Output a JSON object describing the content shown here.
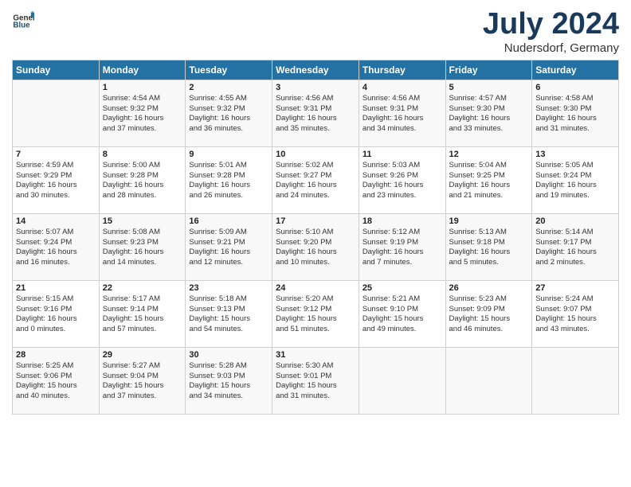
{
  "header": {
    "logo_general": "General",
    "logo_blue": "Blue",
    "month": "July 2024",
    "location": "Nudersdorf, Germany"
  },
  "days_of_week": [
    "Sunday",
    "Monday",
    "Tuesday",
    "Wednesday",
    "Thursday",
    "Friday",
    "Saturday"
  ],
  "weeks": [
    [
      {
        "day": "",
        "info": ""
      },
      {
        "day": "1",
        "info": "Sunrise: 4:54 AM\nSunset: 9:32 PM\nDaylight: 16 hours\nand 37 minutes."
      },
      {
        "day": "2",
        "info": "Sunrise: 4:55 AM\nSunset: 9:32 PM\nDaylight: 16 hours\nand 36 minutes."
      },
      {
        "day": "3",
        "info": "Sunrise: 4:56 AM\nSunset: 9:31 PM\nDaylight: 16 hours\nand 35 minutes."
      },
      {
        "day": "4",
        "info": "Sunrise: 4:56 AM\nSunset: 9:31 PM\nDaylight: 16 hours\nand 34 minutes."
      },
      {
        "day": "5",
        "info": "Sunrise: 4:57 AM\nSunset: 9:30 PM\nDaylight: 16 hours\nand 33 minutes."
      },
      {
        "day": "6",
        "info": "Sunrise: 4:58 AM\nSunset: 9:30 PM\nDaylight: 16 hours\nand 31 minutes."
      }
    ],
    [
      {
        "day": "7",
        "info": "Sunrise: 4:59 AM\nSunset: 9:29 PM\nDaylight: 16 hours\nand 30 minutes."
      },
      {
        "day": "8",
        "info": "Sunrise: 5:00 AM\nSunset: 9:28 PM\nDaylight: 16 hours\nand 28 minutes."
      },
      {
        "day": "9",
        "info": "Sunrise: 5:01 AM\nSunset: 9:28 PM\nDaylight: 16 hours\nand 26 minutes."
      },
      {
        "day": "10",
        "info": "Sunrise: 5:02 AM\nSunset: 9:27 PM\nDaylight: 16 hours\nand 24 minutes."
      },
      {
        "day": "11",
        "info": "Sunrise: 5:03 AM\nSunset: 9:26 PM\nDaylight: 16 hours\nand 23 minutes."
      },
      {
        "day": "12",
        "info": "Sunrise: 5:04 AM\nSunset: 9:25 PM\nDaylight: 16 hours\nand 21 minutes."
      },
      {
        "day": "13",
        "info": "Sunrise: 5:05 AM\nSunset: 9:24 PM\nDaylight: 16 hours\nand 19 minutes."
      }
    ],
    [
      {
        "day": "14",
        "info": "Sunrise: 5:07 AM\nSunset: 9:24 PM\nDaylight: 16 hours\nand 16 minutes."
      },
      {
        "day": "15",
        "info": "Sunrise: 5:08 AM\nSunset: 9:23 PM\nDaylight: 16 hours\nand 14 minutes."
      },
      {
        "day": "16",
        "info": "Sunrise: 5:09 AM\nSunset: 9:21 PM\nDaylight: 16 hours\nand 12 minutes."
      },
      {
        "day": "17",
        "info": "Sunrise: 5:10 AM\nSunset: 9:20 PM\nDaylight: 16 hours\nand 10 minutes."
      },
      {
        "day": "18",
        "info": "Sunrise: 5:12 AM\nSunset: 9:19 PM\nDaylight: 16 hours\nand 7 minutes."
      },
      {
        "day": "19",
        "info": "Sunrise: 5:13 AM\nSunset: 9:18 PM\nDaylight: 16 hours\nand 5 minutes."
      },
      {
        "day": "20",
        "info": "Sunrise: 5:14 AM\nSunset: 9:17 PM\nDaylight: 16 hours\nand 2 minutes."
      }
    ],
    [
      {
        "day": "21",
        "info": "Sunrise: 5:15 AM\nSunset: 9:16 PM\nDaylight: 16 hours\nand 0 minutes."
      },
      {
        "day": "22",
        "info": "Sunrise: 5:17 AM\nSunset: 9:14 PM\nDaylight: 15 hours\nand 57 minutes."
      },
      {
        "day": "23",
        "info": "Sunrise: 5:18 AM\nSunset: 9:13 PM\nDaylight: 15 hours\nand 54 minutes."
      },
      {
        "day": "24",
        "info": "Sunrise: 5:20 AM\nSunset: 9:12 PM\nDaylight: 15 hours\nand 51 minutes."
      },
      {
        "day": "25",
        "info": "Sunrise: 5:21 AM\nSunset: 9:10 PM\nDaylight: 15 hours\nand 49 minutes."
      },
      {
        "day": "26",
        "info": "Sunrise: 5:23 AM\nSunset: 9:09 PM\nDaylight: 15 hours\nand 46 minutes."
      },
      {
        "day": "27",
        "info": "Sunrise: 5:24 AM\nSunset: 9:07 PM\nDaylight: 15 hours\nand 43 minutes."
      }
    ],
    [
      {
        "day": "28",
        "info": "Sunrise: 5:25 AM\nSunset: 9:06 PM\nDaylight: 15 hours\nand 40 minutes."
      },
      {
        "day": "29",
        "info": "Sunrise: 5:27 AM\nSunset: 9:04 PM\nDaylight: 15 hours\nand 37 minutes."
      },
      {
        "day": "30",
        "info": "Sunrise: 5:28 AM\nSunset: 9:03 PM\nDaylight: 15 hours\nand 34 minutes."
      },
      {
        "day": "31",
        "info": "Sunrise: 5:30 AM\nSunset: 9:01 PM\nDaylight: 15 hours\nand 31 minutes."
      },
      {
        "day": "",
        "info": ""
      },
      {
        "day": "",
        "info": ""
      },
      {
        "day": "",
        "info": ""
      }
    ]
  ]
}
